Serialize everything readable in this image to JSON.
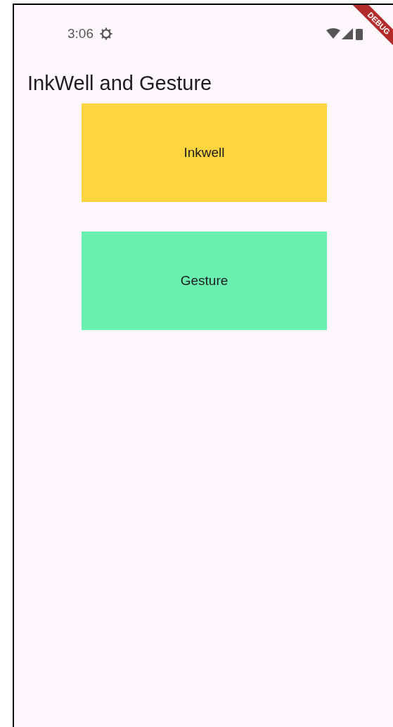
{
  "status_bar": {
    "time": "3:06"
  },
  "debug_banner": {
    "label": "DEBUG"
  },
  "app_bar": {
    "title": "InkWell and Gesture"
  },
  "buttons": [
    {
      "label": "Inkwell",
      "color": "#fed43f"
    },
    {
      "label": "Gesture",
      "color": "#6af0ae"
    }
  ]
}
